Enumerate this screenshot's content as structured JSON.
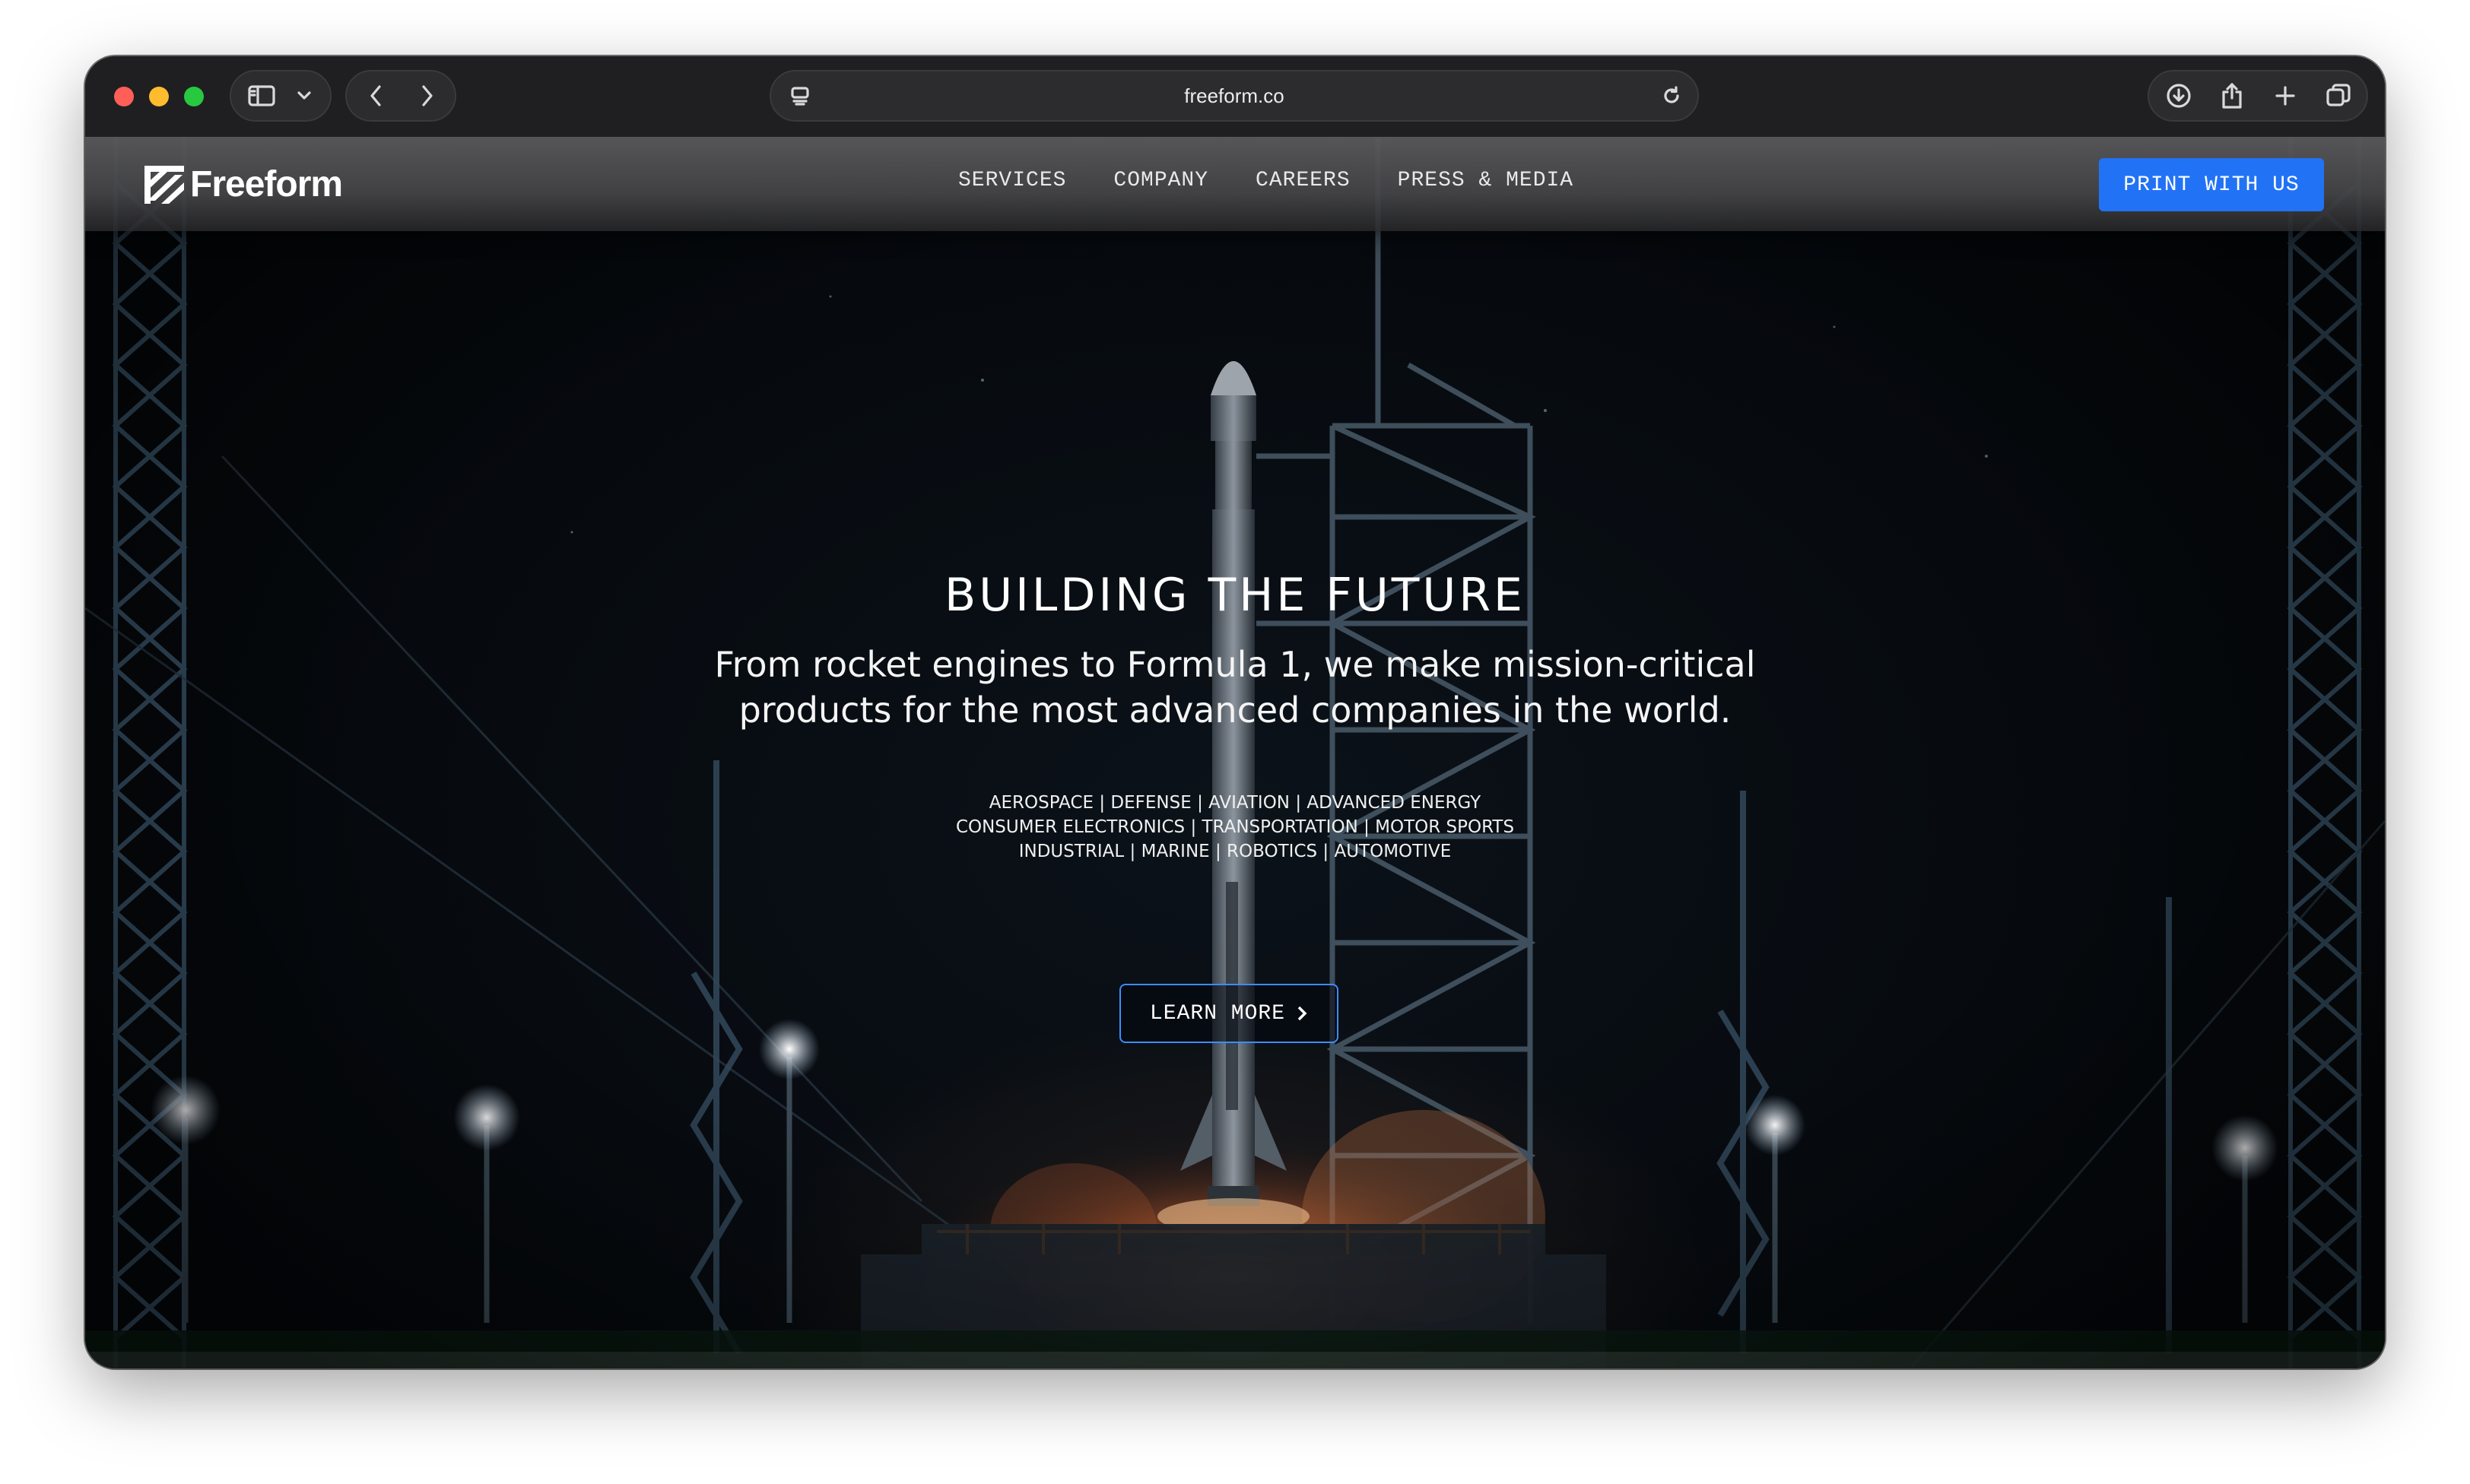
{
  "browser": {
    "url": "freeform.co",
    "icons": {
      "sidebar": "sidebar-icon",
      "sidebar_menu": "chevron-down-icon",
      "back": "chevron-left-icon",
      "forward": "chevron-right-icon",
      "page_settings": "page-menu-icon",
      "reload": "reload-icon",
      "downloads": "download-icon",
      "share": "share-icon",
      "new_tab": "plus-icon",
      "tab_overview": "tabs-icon"
    }
  },
  "site": {
    "logo_text": "Freeform",
    "nav": [
      {
        "label": "SERVICES"
      },
      {
        "label": "COMPANY"
      },
      {
        "label": "CAREERS"
      },
      {
        "label": "PRESS & MEDIA"
      }
    ],
    "cta_label": "PRINT WITH US",
    "colors": {
      "accent": "#2272f5",
      "button_border": "#3d8cff"
    }
  },
  "hero": {
    "title": "BUILDING THE FUTURE",
    "subtitle_line1": "From rocket engines to Formula 1, we make mission-critical",
    "subtitle_line2": "products for the most advanced companies in the world.",
    "industries": [
      "AEROSPACE | DEFENSE | AVIATION | ADVANCED ENERGY",
      "CONSUMER ELECTRONICS | TRANSPORTATION | MOTOR SPORTS",
      "INDUSTRIAL | MARINE | ROBOTICS | AUTOMOTIVE"
    ],
    "learn_more_label": "LEARN MORE"
  }
}
